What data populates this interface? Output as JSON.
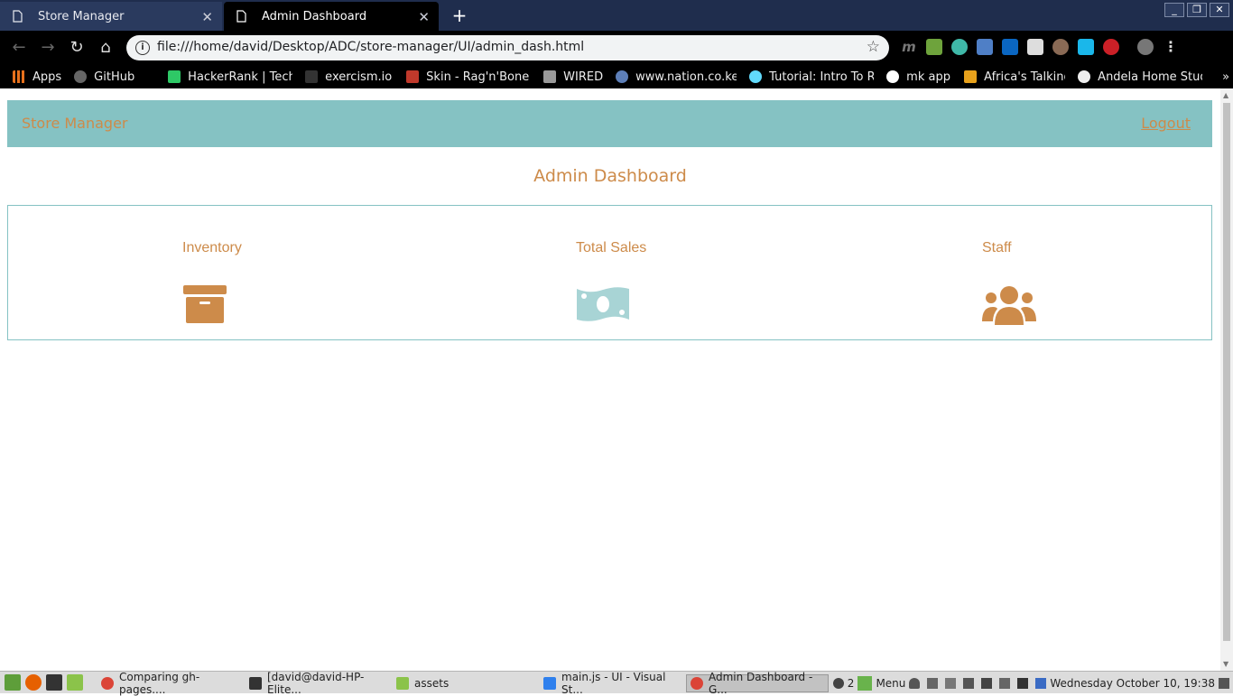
{
  "browser": {
    "tabs": [
      {
        "title": "Store Manager",
        "active": false
      },
      {
        "title": "Admin Dashboard",
        "active": true
      }
    ],
    "url": "file:///home/david/Desktop/ADC/store-manager/UI/admin_dash.html",
    "bookmarks": [
      "Apps",
      "GitHub",
      "HackerRank | Tech",
      "exercism.io",
      "Skin - Rag'n'Bone M",
      "WIRED",
      "www.nation.co.ke",
      "Tutorial: Intro To Re",
      "mk app",
      "Africa's Talking",
      "Andela Home Stud"
    ],
    "bookmarks_more": "»"
  },
  "site": {
    "brand": "Store Manager",
    "logout": "Logout",
    "title": "Admin Dashboard",
    "cards": [
      {
        "label": "Inventory",
        "icon": "archive-box-icon"
      },
      {
        "label": "Total  Sales",
        "icon": "money-bill-icon"
      },
      {
        "label": "Staff",
        "icon": "users-icon"
      }
    ],
    "colors": {
      "accent": "#cd8b4a",
      "nav_bg": "#85c2c3",
      "money_icon": "#a8d4d5"
    }
  },
  "taskbar": {
    "tasks": [
      "Comparing gh-pages....",
      "[david@david-HP-Elite...",
      "assets",
      "main.js - UI - Visual St...",
      "Admin Dashboard - G..."
    ],
    "notification_count": "2",
    "menu": "Menu",
    "clock": "Wednesday October 10, 19:38"
  }
}
